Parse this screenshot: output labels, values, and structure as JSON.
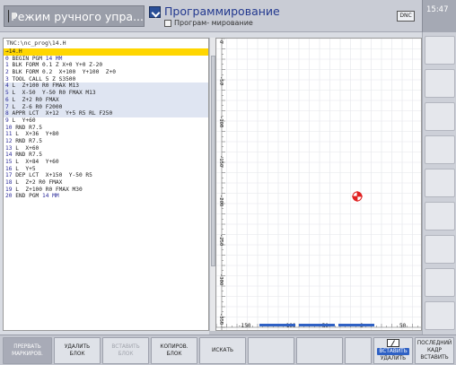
{
  "header": {
    "left_mode": "Режим ручного упра...",
    "right_mode_title": "Программирование",
    "right_mode_sub": "Програм- мирование",
    "dnc_label": "DNC",
    "clock": "15:47"
  },
  "program": {
    "path": "TNC:\\nc_prog\\14.H",
    "selected": "→14.H",
    "lines": [
      {
        "n": "0",
        "text": "BEGIN PGM ",
        "extra": "14 MM",
        "hl": false
      },
      {
        "n": "1",
        "text": "BLK FORM 0.1 Z X+0 Y+0 Z-20",
        "extra": "",
        "hl": false
      },
      {
        "n": "2",
        "text": "BLK FORM 0.2  X+100  Y+100  Z+0",
        "extra": "",
        "hl": false
      },
      {
        "n": "3",
        "text": "TOOL CALL 5 Z S3500",
        "extra": "",
        "hl": false
      },
      {
        "n": "4",
        "text": "L  Z+100 R0 FMAX M13",
        "extra": "",
        "hl": true
      },
      {
        "n": "5",
        "text": "L  X-50  Y-50 R0 FMAX M13",
        "extra": "",
        "hl": true
      },
      {
        "n": "6",
        "text": "L  Z+2 R0 FMAX",
        "extra": "",
        "hl": true
      },
      {
        "n": "7",
        "text": "L  Z-6 R0 F2000",
        "extra": "",
        "hl": true
      },
      {
        "n": "8",
        "text": "APPR LCT  X+12  Y+5 R5 RL F250",
        "extra": "",
        "hl": true
      },
      {
        "n": "9",
        "text": "L  Y+60",
        "extra": "",
        "hl": false
      },
      {
        "n": "10",
        "text": "RND R7.5",
        "extra": "",
        "hl": false
      },
      {
        "n": "11",
        "text": "L  X+36  Y+80",
        "extra": "",
        "hl": false
      },
      {
        "n": "12",
        "text": "RND R7.5",
        "extra": "",
        "hl": false
      },
      {
        "n": "13",
        "text": "L  X+60",
        "extra": "",
        "hl": false
      },
      {
        "n": "14",
        "text": "RND R7.5",
        "extra": "",
        "hl": false
      },
      {
        "n": "15",
        "text": "L  X+84  Y+60",
        "extra": "",
        "hl": false
      },
      {
        "n": "16",
        "text": "L  Y+5",
        "extra": "",
        "hl": false
      },
      {
        "n": "17",
        "text": "DEP LCT  X+150  Y-50 R5",
        "extra": "",
        "hl": false
      },
      {
        "n": "18",
        "text": "L  Z+2 R0 FMAX",
        "extra": "",
        "hl": false
      },
      {
        "n": "19",
        "text": "L  Z+100 R0 FMAX M30",
        "extra": "",
        "hl": false
      },
      {
        "n": "20",
        "text": "END PGM ",
        "extra": "14 MM",
        "hl": false
      }
    ]
  },
  "graphics": {
    "v_labels": [
      "0",
      "-50",
      "-100",
      "-150",
      "-200",
      "-250",
      "-300",
      "-350"
    ],
    "h_labels": [
      "-150",
      "-100",
      "-50",
      "0",
      "50"
    ]
  },
  "softkeys": {
    "k1_l1": "ПРЕРВАТЬ",
    "k1_l2": "МАРКИРОВ.",
    "k2_l1": "УДАЛИТЬ",
    "k2_l2": "БЛОК",
    "k3_l1": "ВСТАВИТЬ",
    "k3_l2": "БЛОК",
    "k4_l1": "КОПИРОВ.",
    "k4_l2": "БЛОК",
    "k5": "ИСКАТЬ",
    "k8_active": "ВСТАВИТЬ",
    "k8_inactive": "УДАЛИТЬ",
    "k9_l1": "ПОСЛЕДНИЙ",
    "k9_l2": "КАДР",
    "k9_l3": "ВСТАВИТЬ"
  }
}
